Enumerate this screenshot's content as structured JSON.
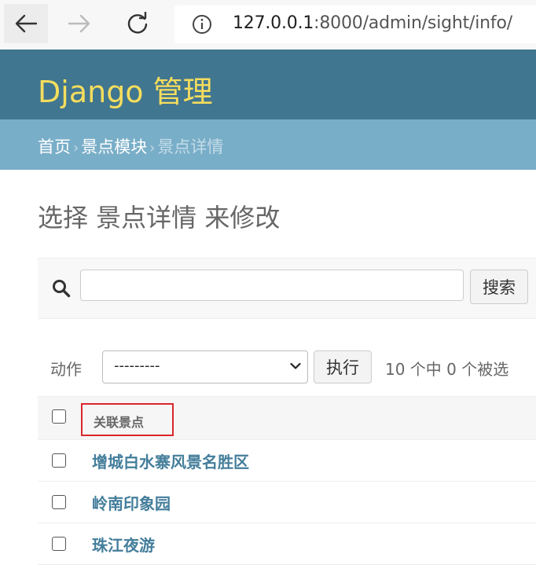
{
  "browser": {
    "url_host": "127.0.0.1",
    "url_rest": ":8000/admin/sight/info/",
    "back_icon": "back-arrow-icon",
    "forward_icon": "forward-arrow-icon",
    "reload_icon": "reload-icon",
    "info_icon": "info-icon"
  },
  "header": {
    "brand": "Django 管理",
    "brand_color": "#f5dd5d",
    "bg_color": "#417690"
  },
  "breadcrumbs": {
    "home": "首页",
    "separator": "›",
    "app": "景点模块",
    "current": "景点详情"
  },
  "page": {
    "title": "选择 景点详情 来修改"
  },
  "search": {
    "value": "",
    "placeholder": "",
    "button_label": "搜索"
  },
  "actions": {
    "label": "动作",
    "selected": "---------",
    "go_label": "执行",
    "counter": "10 个中 0 个被选"
  },
  "table": {
    "column_header": "关联景点",
    "rows": [
      {
        "label": "增城白水寨风景名胜区"
      },
      {
        "label": "岭南印象园"
      },
      {
        "label": "珠江夜游"
      }
    ]
  },
  "colors": {
    "link": "#447e9b",
    "breadcrumb_bg": "#79aec8",
    "highlight_border": "#d9262b"
  }
}
